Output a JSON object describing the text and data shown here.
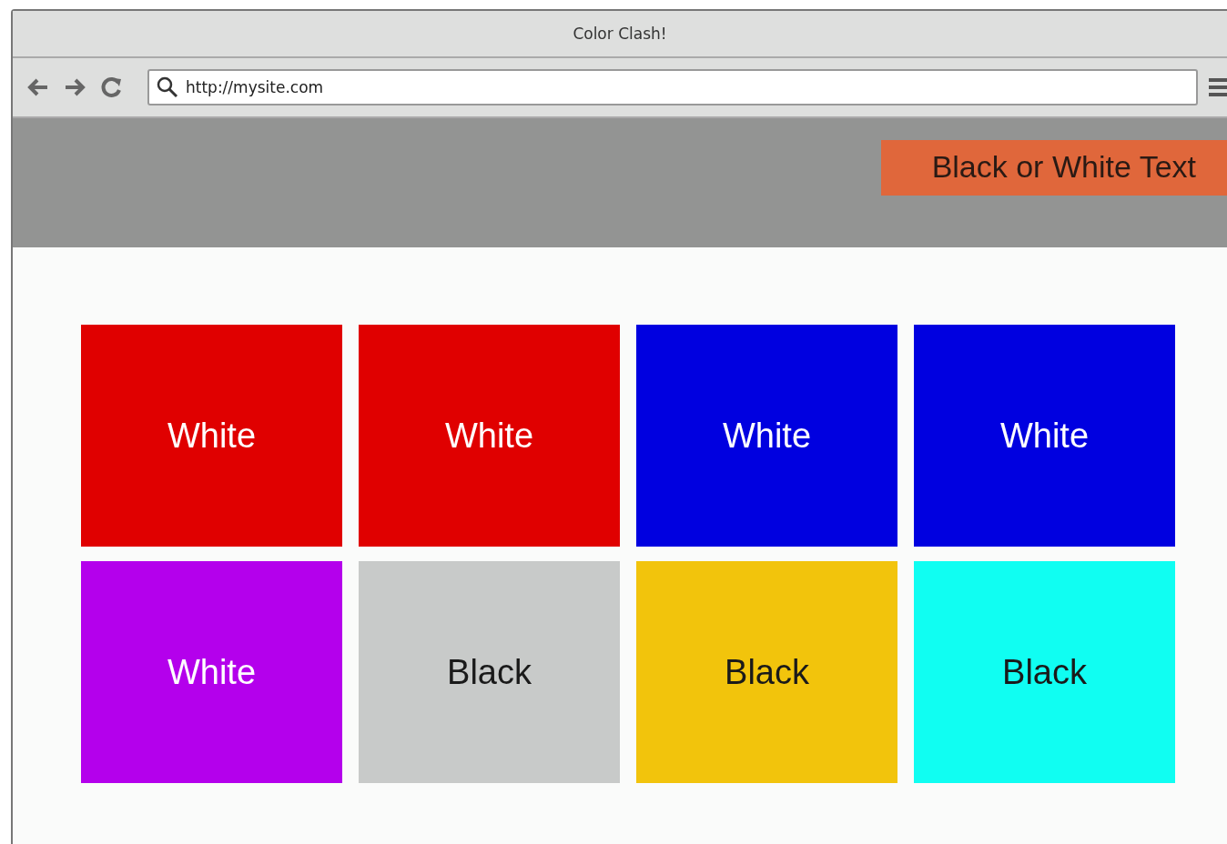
{
  "window": {
    "title": "Color Clash!"
  },
  "toolbar": {
    "address": "http://mysite.com"
  },
  "header": {
    "banner": "Black or White Text"
  },
  "tiles": [
    {
      "label": "White",
      "color": "#e00000",
      "kind": "light"
    },
    {
      "label": "White",
      "color": "#e00000",
      "kind": "light"
    },
    {
      "label": "White",
      "color": "#0000e0",
      "kind": "light"
    },
    {
      "label": "White",
      "color": "#0000e0",
      "kind": "light"
    },
    {
      "label": "White",
      "color": "#b400ec",
      "kind": "light"
    },
    {
      "label": "Black",
      "color": "#c8cac9",
      "kind": "dark"
    },
    {
      "label": "Black",
      "color": "#f2c40c",
      "kind": "dark"
    },
    {
      "label": "Black",
      "color": "#10fef2",
      "kind": "dark"
    }
  ]
}
